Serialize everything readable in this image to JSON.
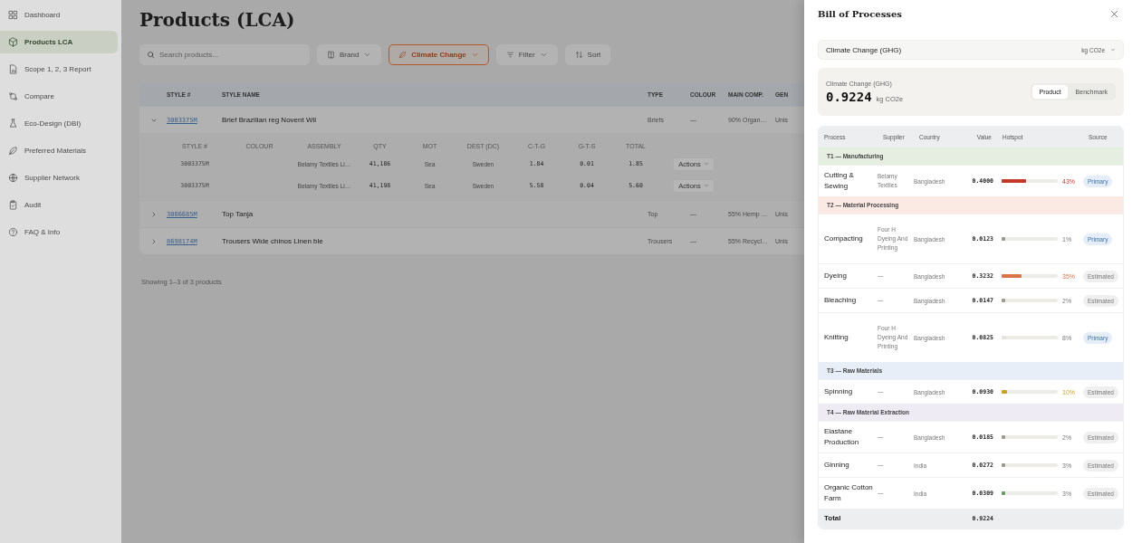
{
  "sidebar": {
    "items": [
      {
        "label": "Dashboard",
        "selected": false
      },
      {
        "label": "Products LCA",
        "selected": true
      },
      {
        "label": "Scope 1, 2, 3 Report",
        "selected": false
      },
      {
        "label": "Compare",
        "selected": false
      },
      {
        "label": "Eco-Design (DBI)",
        "selected": false
      },
      {
        "label": "Preferred Materials",
        "selected": false
      },
      {
        "label": "Supplier Network",
        "selected": false
      },
      {
        "label": "Audit",
        "selected": false
      },
      {
        "label": "FAQ & Info",
        "selected": false
      }
    ]
  },
  "page": {
    "title": "Products (LCA)"
  },
  "toolbar": {
    "search": {
      "placeholder": "Search products..."
    },
    "filters": [
      {
        "label": "Brand",
        "active": false
      },
      {
        "label": "Climate Change",
        "active": true
      },
      {
        "label": "Filter",
        "active": false
      },
      {
        "label": "Sort",
        "active": false
      }
    ]
  },
  "table": {
    "columns": [
      "STYLE #",
      "STYLE NAME",
      "TYPE",
      "COLOUR",
      "MAIN COMP.",
      "GEN"
    ],
    "rows": [
      {
        "expanded": true,
        "style": "3003375M",
        "name": "Brief Brazilian reg Novent Wil",
        "type": "Briefs",
        "colour": "—",
        "main_comp": "90% Organ…",
        "gen": "Unis",
        "details": {
          "columns": [
            "STYLE #",
            "COLOUR",
            "ASSEMBLY",
            "QTY",
            "MOT",
            "DEST (DC)",
            "C-T-G",
            "G-T-S",
            "TOTAL"
          ],
          "rows": [
            {
              "style": "3003375M",
              "assembly": "Belamy Textiles Li…",
              "qty": "41,186",
              "mot": "Sea",
              "dest": "Sweden",
              "ctg": "1.84",
              "gts": "0.01",
              "total": "1.85",
              "action": "Actions"
            },
            {
              "style": "3003375M",
              "assembly": "Belamy Textiles Li…",
              "qty": "41,198",
              "mot": "Sea",
              "dest": "Sweden",
              "ctg": "5.58",
              "gts": "0.04",
              "total": "5.60",
              "action": "Actions"
            }
          ]
        }
      },
      {
        "expanded": false,
        "style": "3006685M",
        "name": "Top Tanja",
        "type": "Top",
        "colour": "—",
        "main_comp": "55% Hemp …",
        "gen": "Unis"
      },
      {
        "expanded": false,
        "style": "8698174M",
        "name": "Trousers Wide chinos Linen ble",
        "type": "Trousers",
        "colour": "—",
        "main_comp": "55% Recycl…",
        "gen": "Unis"
      }
    ],
    "footer": "Showing 1–3 of 3 products"
  },
  "drawer": {
    "title": "Bill of Processes",
    "impact_select": {
      "value": "Climate Change (GHG)",
      "unit": "kg CO2e"
    },
    "summary": {
      "label": "Climate Change (GHG)",
      "value": "0.9224",
      "unit": "kg CO2e",
      "segments": [
        {
          "label": "Product",
          "selected": true
        },
        {
          "label": "Benchmark",
          "selected": false
        }
      ]
    },
    "processes": {
      "columns": [
        "Process",
        "Supplier",
        "Country",
        "Value",
        "Hotspot",
        "Source"
      ],
      "groups": [
        {
          "label": "T1 — Manufacturing",
          "color": "#e6eee2",
          "rows": [
            {
              "process": "Cutting & Sewing",
              "supplier": "Belamy Textiles",
              "country": "Bangladesh",
              "value": "0.4000",
              "level": 0.43,
              "percent": "43%",
              "color": "#c0392b",
              "source": "Primary",
              "kind": "primary"
            }
          ]
        },
        {
          "label": "T2 — Material Processing",
          "color": "#fbe9e4",
          "rows": [
            {
              "process": "Compacting",
              "supplier": "Four H Dyeing And Printing",
              "country": "Bangladesh",
              "value": "0.0123",
              "level": 0.01,
              "percent": "1%",
              "color": "#9a9a8e",
              "source": "Primary",
              "kind": "primary"
            },
            {
              "process": "Dyeing",
              "supplier": "—",
              "country": "Bangladesh",
              "value": "0.3232",
              "level": 0.35,
              "percent": "35%",
              "color": "#d9744a",
              "source": "Estimated",
              "kind": "estimated"
            },
            {
              "process": "Bleaching",
              "supplier": "—",
              "country": "Bangladesh",
              "value": "0.0147",
              "level": 0.02,
              "percent": "2%",
              "color": "#9a9a8e",
              "source": "Estimated",
              "kind": "estimated"
            },
            {
              "process": "Knitting",
              "supplier": "Four H Dyeing And Printing",
              "country": "Bangladesh",
              "value": "0.0825",
              "level": 0.08,
              "percent": "8%",
              "color": "#e4e2dc",
              "source": "Primary",
              "kind": "primary"
            }
          ]
        },
        {
          "label": "T3 — Raw Materials",
          "color": "#e7eef7",
          "rows": [
            {
              "process": "Spinning",
              "supplier": "—",
              "country": "Bangladesh",
              "value": "0.0930",
              "level": 0.1,
              "percent": "10%",
              "color": "#c9a227",
              "source": "Estimated",
              "kind": "estimated"
            }
          ]
        },
        {
          "label": "T4 — Raw Material Extraction",
          "color": "#efebf5",
          "rows": [
            {
              "process": "Elastane Production",
              "supplier": "—",
              "country": "Bangladesh",
              "value": "0.0185",
              "level": 0.02,
              "percent": "2%",
              "color": "#9a9a8e",
              "source": "Estimated",
              "kind": "estimated"
            },
            {
              "process": "Ginning",
              "supplier": "—",
              "country": "India",
              "value": "0.0272",
              "level": 0.03,
              "percent": "3%",
              "color": "#9a9a8e",
              "source": "Estimated",
              "kind": "estimated"
            },
            {
              "process": "Organic Cotton Farm",
              "supplier": "—",
              "country": "India",
              "value": "0.0309",
              "level": 0.03,
              "percent": "3%",
              "color": "#6f9a62",
              "source": "Estimated",
              "kind": "estimated"
            }
          ]
        }
      ],
      "total": {
        "label": "Total",
        "value": "0.9224"
      }
    }
  }
}
